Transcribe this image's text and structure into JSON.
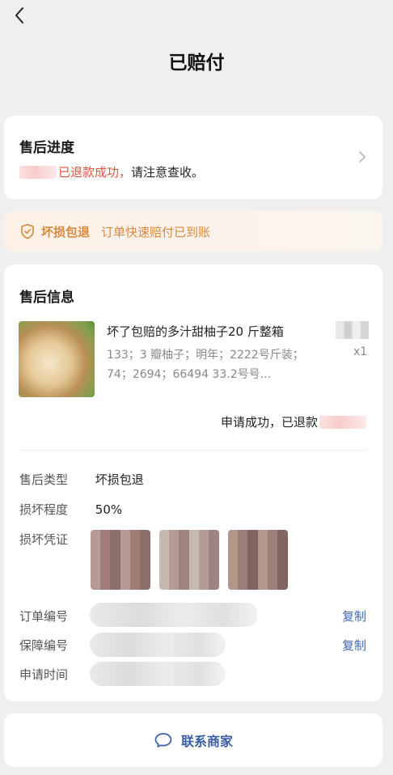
{
  "header": {
    "title": "已赔付"
  },
  "progress": {
    "heading": "售后进度",
    "status_red": "已退款成功，",
    "status_rest": "请注意查收。"
  },
  "banner": {
    "tag": "坏损包退",
    "message": "订单快速赔付已到账",
    "accent": "#d8893e"
  },
  "info": {
    "heading": "售后信息",
    "product": {
      "name": "坏了包赔的多汁甜柚子20 斤整箱",
      "spec": "133；3 瓣柚子；明年；2222号斤装；74；2694；66494 33.2号号...",
      "qty": "x1"
    },
    "status": "申请成功，已退款",
    "rows": {
      "type_label": "售后类型",
      "type_value": "坏损包退",
      "degree_label": "损坏程度",
      "degree_value": "50%",
      "proof_label": "损坏凭证",
      "order_label": "订单编号",
      "guarantee_label": "保障编号",
      "time_label": "申请时间",
      "copy": "复制"
    }
  },
  "contact": {
    "label": "联系商家"
  },
  "colors": {
    "link": "#3f6bb5",
    "red": "#e2533a",
    "background": "#efefef"
  }
}
